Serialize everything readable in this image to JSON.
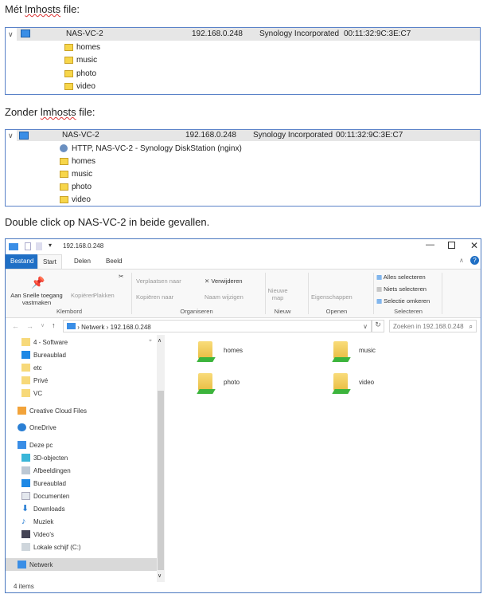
{
  "section1": {
    "heading_pre": "Mét ",
    "heading_word": "lmhosts",
    "heading_post": " file:",
    "device": {
      "name": "NAS-VC-2",
      "ip": "192.168.0.248",
      "vendor": "Synology Incorporated",
      "mac": "00:11:32:9C:3E:C7"
    },
    "items": [
      "homes",
      "music",
      "photo",
      "video"
    ]
  },
  "section2": {
    "heading_pre": "Zonder ",
    "heading_word": "lmhosts",
    "heading_post": " file:",
    "device": {
      "name": "NAS-VC-2",
      "ip": "192.168.0.248",
      "vendor": "Synology Incorporated",
      "mac": "00:11:32:9C:3E:C7"
    },
    "service": "HTTP, NAS-VC-2 - Synology DiskStation (nginx)",
    "items": [
      "homes",
      "music",
      "photo",
      "video"
    ]
  },
  "caption": "Double click op NAS-VC-2 in beide gevallen.",
  "explorer": {
    "title": "192.168.0.248",
    "tabs": [
      "Bestand",
      "Start",
      "Delen",
      "Beeld"
    ],
    "ribbon": {
      "pin": "Aan Snelle toegang vastmaken",
      "copy": "Kopiëren",
      "paste": "Plakken",
      "move_to": "Verplaatsen naar",
      "copy_to": "Kopiëren naar",
      "delete": "Verwijderen",
      "rename": "Naam wijzigen",
      "new_folder": "Nieuwe map",
      "properties": "Eigenschappen",
      "select_all": "Alles selecteren",
      "select_none": "Niets selecteren",
      "invert": "Selectie omkeren",
      "groups": [
        "Klembord",
        "Organiseren",
        "Nieuw",
        "Openen",
        "Selecteren"
      ]
    },
    "address": [
      "Netwerk",
      "192.168.0.248"
    ],
    "search_placeholder": "Zoeken in 192.168.0.248",
    "nav": [
      "4 - Software",
      "Bureaublad",
      "etc",
      "Privé",
      "VC",
      "Creative Cloud Files",
      "OneDrive",
      "Deze pc",
      "3D-objecten",
      "Afbeeldingen",
      "Bureaublad",
      "Documenten",
      "Downloads",
      "Muziek",
      "Video's",
      "Lokale schijf (C:)",
      "Netwerk"
    ],
    "shares": [
      "homes",
      "music",
      "photo",
      "video"
    ],
    "status": "4 items"
  }
}
